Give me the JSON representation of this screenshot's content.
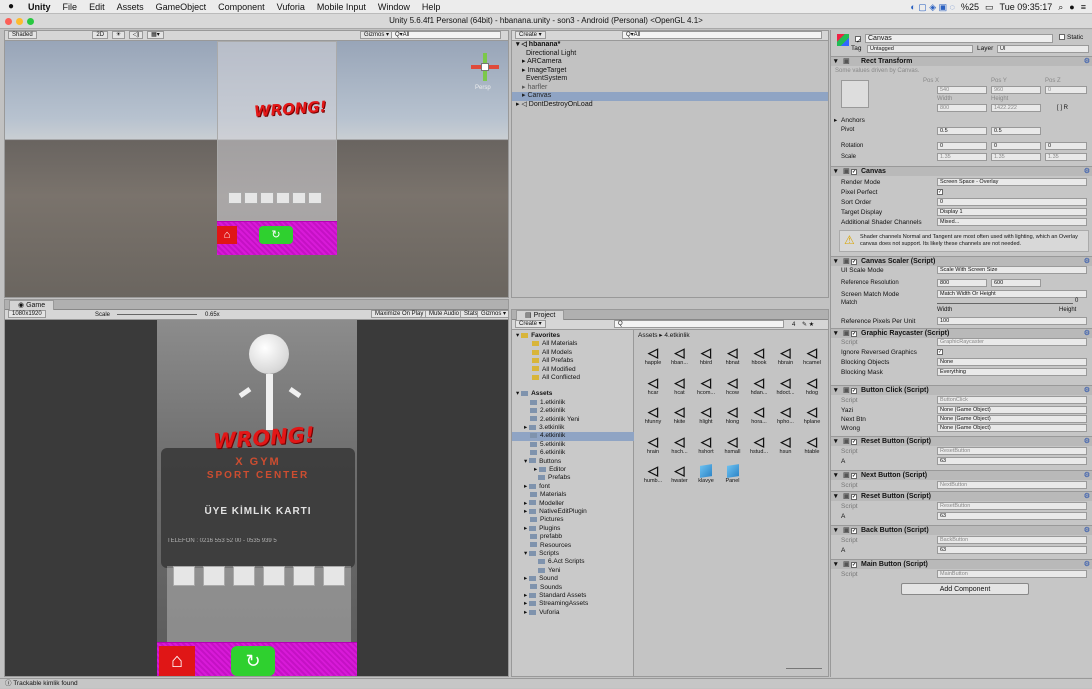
{
  "menubar": {
    "apple": "",
    "items": [
      "Unity",
      "File",
      "Edit",
      "Assets",
      "GameObject",
      "Component",
      "Vuforia",
      "Mobile Input",
      "Window",
      "Help"
    ],
    "battery": "%25",
    "clock": "Tue 09:35:17"
  },
  "window": {
    "title": "Unity 5.6.4f1 Personal (64bit) - hbanana.unity - son3 - Android (Personal) <OpenGL 4.1>"
  },
  "scene": {
    "shading": "Shaded",
    "mode2d": "2D",
    "gizmos": "Gizmos ▾",
    "search": "Q▾All",
    "persp": "Persp",
    "wrong": "WRONG!"
  },
  "game": {
    "tab": "Game",
    "resolution": "1080x1920",
    "scale_label": "Scale",
    "scale_value": "0.65x",
    "toggles": [
      "Maximize On Play",
      "Mute Audio",
      "Stats",
      "Gizmos ▾"
    ],
    "wrong": "WRONG!",
    "card_line1": "X GYM",
    "card_line2": "SPORT CENTER",
    "card_title": "ÜYE KİMLİK KARTI",
    "card_phone": "TELEFON : 0216 553 52 00 - 0535 939 5"
  },
  "hierarchy": {
    "create": "Create ▾",
    "search": "Q▾All",
    "scene": "hbanana*",
    "items": [
      "Directional Light",
      "ARCamera",
      "ImageTarget",
      "EventSystem",
      "harfler",
      "Canvas",
      "DontDestroyOnLoad"
    ]
  },
  "project": {
    "tab": "Project",
    "create": "Create ▾",
    "breadcrumb": "Assets ▸ 4.etkinlik",
    "favorites_header": "Favorites",
    "favorites": [
      "All Materials",
      "All Models",
      "All Prefabs",
      "All Modified",
      "All Conflicted"
    ],
    "assets_header": "Assets",
    "folders": [
      "1.etkinlik",
      "2.etkinlik",
      "2.etkinlik Yeni",
      "3.etkinlik",
      "4.etkinlik",
      "5.etkinlik",
      "6.etkinlik",
      "Buttons",
      "Editor",
      "Prefabs",
      "font",
      "Materials",
      "Modeller",
      "NativeEditPlugin",
      "Pictures",
      "Plugins",
      "prefabb",
      "Resources",
      "Scripts",
      "6.Act Scripts",
      "Yeni",
      "Sound",
      "Sounds",
      "Standard Assets",
      "StreamingAssets",
      "Vuforia"
    ],
    "count": "4",
    "assets": [
      "happle",
      "hban...",
      "hbird",
      "hbnat",
      "hbook",
      "hbrain",
      "hcamel",
      "hcar",
      "hcat",
      "hcom...",
      "hcow",
      "hdan...",
      "hdoct...",
      "hdog",
      "hfunny",
      "hkite",
      "hlight",
      "hlong",
      "hora...",
      "hpho...",
      "hplane",
      "hrain",
      "hsch...",
      "hshort",
      "hsmall",
      "hstud...",
      "hsun",
      "htable",
      "humb...",
      "hwater",
      "klavye",
      "Panel"
    ]
  },
  "inspector": {
    "name": "Canvas",
    "static": "Static",
    "tag_label": "Tag",
    "tag": "Untagged",
    "layer_label": "Layer",
    "layer": "UI",
    "rect": {
      "title": "Rect Transform",
      "note": "Some values driven by Canvas.",
      "posx_l": "Pos X",
      "posy_l": "Pos Y",
      "posz_l": "Pos Z",
      "posx": "540",
      "posy": "960",
      "posz": "0",
      "w_l": "Width",
      "h_l": "Height",
      "w": "800",
      "h": "1422.222",
      "anchors": "Anchors",
      "pivot": "Pivot",
      "pivx": "0.5",
      "pivy": "0.5",
      "rotation": "Rotation",
      "rotx": "0",
      "roty": "0",
      "rotz": "0",
      "scale": "Scale",
      "scx": "1.35",
      "scy": "1.35",
      "scz": "1.35"
    },
    "canvas": {
      "title": "Canvas",
      "rows": [
        [
          "Render Mode",
          "Screen Space - Overlay"
        ],
        [
          "Pixel Perfect",
          ""
        ],
        [
          "Sort Order",
          "0"
        ],
        [
          "Target Display",
          "Display 1"
        ],
        [
          "Additional Shader Channels",
          "Mixed..."
        ]
      ],
      "warning": "Shader channels Normal and Tangent are most often used with lighting, which an Overlay canvas does not support. Its likely these channels are not needed."
    },
    "scaler": {
      "title": "Canvas Scaler (Script)",
      "mode_l": "UI Scale Mode",
      "mode": "Scale With Screen Size",
      "ref_l": "Reference Resolution",
      "refx": "800",
      "refy": "600",
      "match_l": "Screen Match Mode",
      "match": "Match Width Or Height",
      "matchw_l": "Match",
      "match_val": "0",
      "width_l": "Width",
      "height_l": "Height",
      "ppu_l": "Reference Pixels Per Unit",
      "ppu": "100"
    },
    "raycaster": {
      "title": "Graphic Raycaster (Script)",
      "script": "GraphicRaycaster",
      "rows": [
        [
          "Ignore Reversed Graphics",
          ""
        ],
        [
          "Blocking Objects",
          "None"
        ],
        [
          "Blocking Mask",
          "Everything"
        ]
      ]
    },
    "btnclick": {
      "title": "Button Click (Script)",
      "script": "ButtonClick",
      "rows": [
        [
          "Yazi",
          "None (Game Object)"
        ],
        [
          "Next Btn",
          "None (Game Object)"
        ],
        [
          "Wrong",
          "None (Game Object)"
        ]
      ]
    },
    "reset1": {
      "title": "Reset Button (Script)",
      "script": "ResetButton",
      "a": "A",
      "aval": "63"
    },
    "next": {
      "title": "Next Button (Script)",
      "script": "NextButton"
    },
    "reset2": {
      "title": "Reset Button (Script)",
      "script": "ResetButton",
      "a": "A",
      "aval": "63"
    },
    "back": {
      "title": "Back Button (Script)",
      "script": "BackButton",
      "a": "A",
      "aval": "63"
    },
    "main": {
      "title": "Main Button (Script)",
      "script": "MainButton"
    },
    "script_l": "Script",
    "add_component": "Add Component"
  },
  "status": {
    "text": "Trackable kimlik found"
  },
  "colors": {
    "pink": "#d81ad8",
    "wrong_red": "#e21717",
    "green_piece": "#2fd02f",
    "red_piece": "#e01616",
    "selection": "#8fa4c4"
  }
}
